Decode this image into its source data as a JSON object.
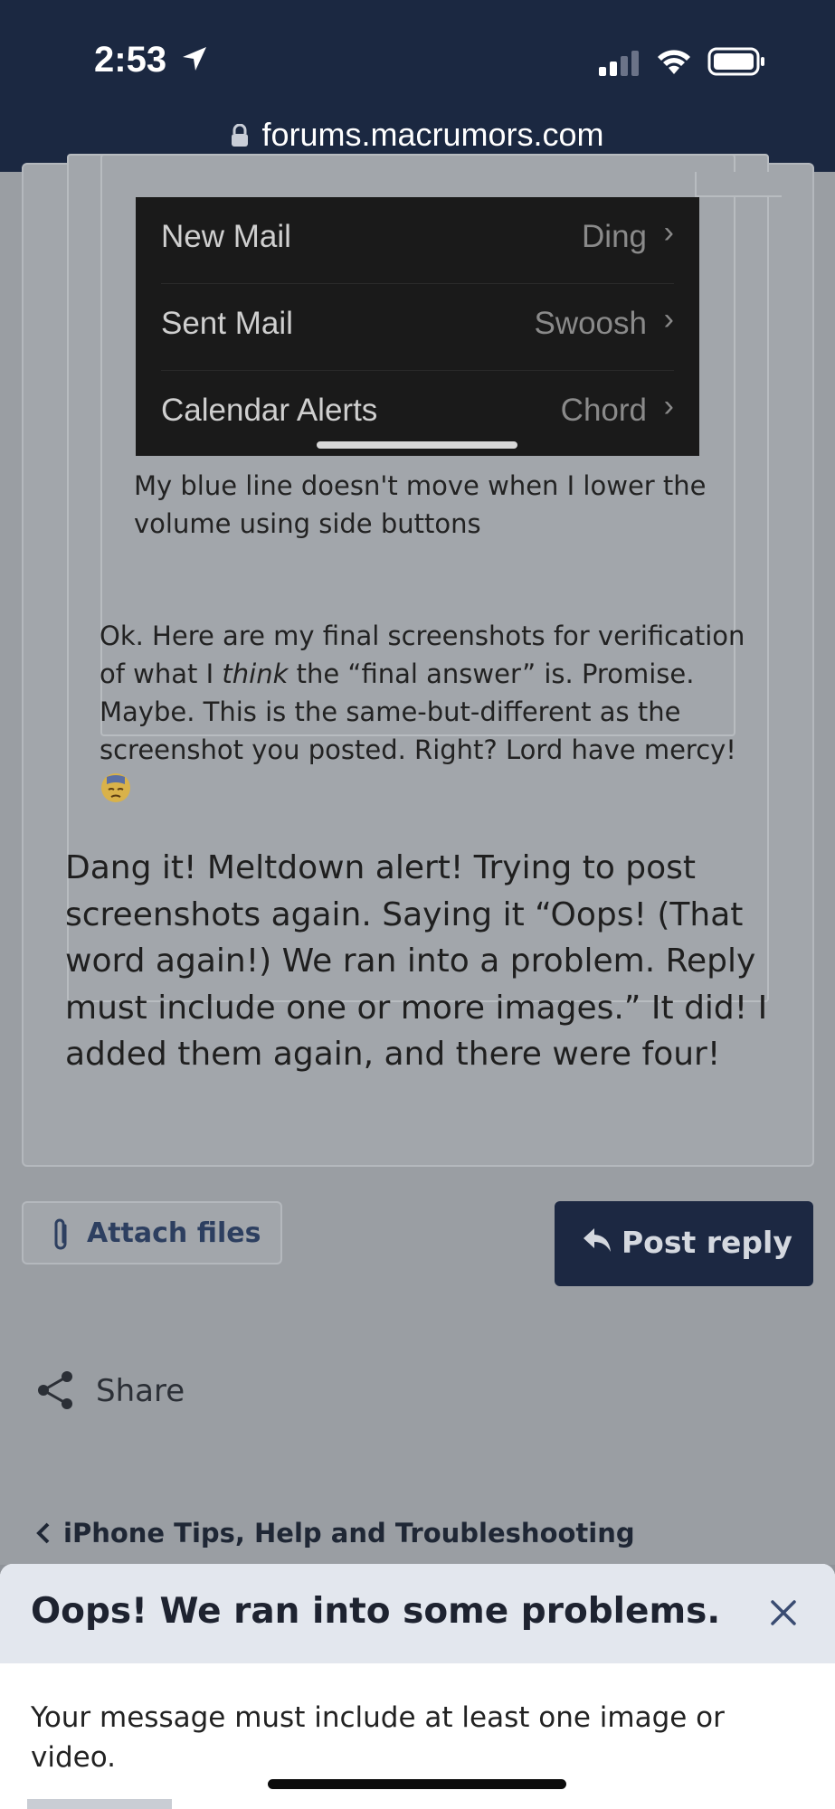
{
  "status_bar": {
    "time": "2:53"
  },
  "url_bar": {
    "domain": "forums.macrumors.com"
  },
  "quoted_screenshot": {
    "rows": [
      {
        "label": "New Mail",
        "value": "Ding"
      },
      {
        "label": "Sent Mail",
        "value": "Swoosh"
      },
      {
        "label": "Calendar Alerts",
        "value": "Chord"
      }
    ]
  },
  "inner_quote_caption": "My blue line doesn't move when I lower the volume using side buttons",
  "outer_quote": {
    "text_before": "Ok. Here are my final screenshots for verification of what I ",
    "text_italic": "think",
    "text_after": " the “final answer” is. Promise. Maybe. This is the same-but-different as the screenshot you posted. Right? Lord have mercy!"
  },
  "reply_text": "Dang it! Meltdown alert! Trying to post screenshots again. Saying it “Oops! (That word again!) We ran into a problem. Reply must include one or more images.” It did! I added them again, and there were four!",
  "actions": {
    "attach_label": "Attach files",
    "post_reply_label": "Post reply",
    "share_label": "Share"
  },
  "breadcrumb": {
    "label": "iPhone Tips, Help and Troubleshooting"
  },
  "error_sheet": {
    "title": "Oops! We ran into some problems.",
    "message": "Your message must include at least one image or video."
  },
  "colors": {
    "navy": "#1b2841",
    "accent_link": "#2d3f60",
    "sheet_header": "#e3e7ee"
  },
  "icons": [
    "location-arrow-icon",
    "signal-icon",
    "wifi-icon",
    "battery-icon",
    "lock-icon",
    "paperclip-icon",
    "reply-arrow-icon",
    "share-icon",
    "chevron-left-icon",
    "close-icon",
    "sweat-emoji-icon"
  ]
}
